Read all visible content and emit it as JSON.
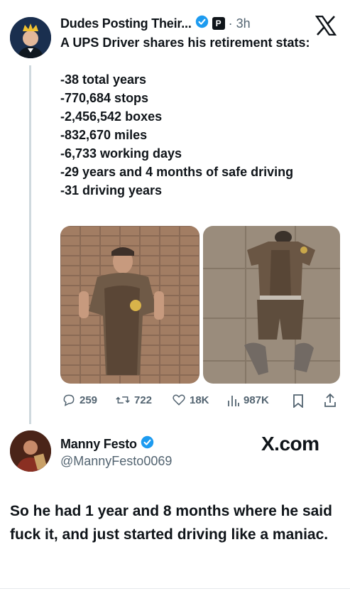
{
  "post": {
    "author": "Dudes Posting Their...",
    "time": "· 3h",
    "badge_letter": "P",
    "text": "A UPS Driver shares his retirement stats:\n\n-38 total years\n-770,684 stops\n-2,456,542 boxes\n-832,670 miles\n-6,733 working days\n-29 years and 4 months of safe driving\n-31 driving years",
    "actions": {
      "replies": "259",
      "reposts": "722",
      "likes": "18K",
      "views": "987K"
    }
  },
  "reply": {
    "author": "Manny Festo",
    "handle": "@MannyFesto0069",
    "brand": "X.com",
    "text": "So he had 1 year and 8 months where he said fuck it, and just started driving like a maniac."
  },
  "colors": {
    "verified": "#1d9bf0",
    "muted": "#536471",
    "ups_brown": "#6b5440"
  }
}
